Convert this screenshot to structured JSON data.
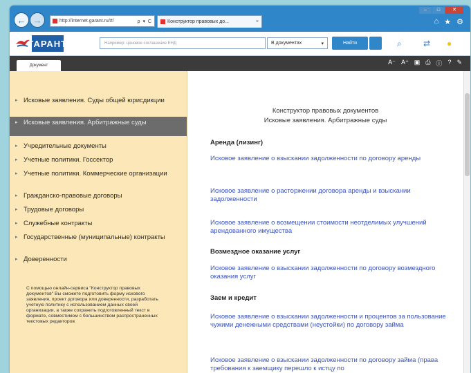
{
  "browser": {
    "address": "http://internet.garant.ru/#/",
    "address_tools": "ρ ▾ C",
    "tab_title": "Конструктор правовых до...",
    "tab_close": "×",
    "back": "←",
    "forward": "→"
  },
  "toolbar": {
    "logo_text": "ГАРАНТ",
    "search_placeholder": "Например: ценовое соглашение ЕНД",
    "scope_label": "В документах",
    "scope_arrow": "▾",
    "find_label": "Найти"
  },
  "doc_tab": "Документ",
  "sidebar": {
    "items": [
      "Исковые заявления. Суды общей юрисдикции",
      "Исковые заявления. Арбитражные суды",
      "Учредительные документы",
      "Учетные политики. Госсектор",
      "Учетные политики. Коммерческие организации",
      "Гражданско-правовые договоры",
      "Трудовые договоры",
      "Служебные контракты",
      "Государственные (муниципальные) контракты",
      "Доверенности"
    ],
    "active_index": 1,
    "note": "С помощью онлайн-сервиса \"Конструктор правовых документов\" Вы сможете подготовить форму искового заявления, проект договора или доверенности, разработать учетную политику с использованием данных своей организации, а также сохранить подготовленный текст в формате, совместимом с большинством распространенных текстовых редакторов"
  },
  "main": {
    "title_line1": "Конструктор правовых документов",
    "title_line2": "Исковые заявления. Арбитражные суды",
    "sections": [
      {
        "heading": "Аренда (лизинг)",
        "links": [
          "Исковое заявление о взыскании задолженности по договору аренды",
          "Исковое заявление о расторжении договора аренды и взыскании задолженности",
          "Исковое заявление о возмещении стоимости неотделимых улучшений арендованного имущества"
        ]
      },
      {
        "heading": "Возмездное оказание услуг",
        "links": [
          "Исковое заявление о взыскании задолженности по договору возмездного оказания услуг"
        ]
      },
      {
        "heading": "Заем и кредит",
        "links": [
          "Исковое заявление о взыскании задолженности и процентов за пользование чужими денежными средствами (неустойки) по договору займа",
          "Исковое заявление о взыскании задолженности по договору займа (права требования к заемщику перешло к истцу по"
        ]
      }
    ]
  },
  "colors": {
    "frame_blue": "#2f86c9",
    "sidebar_bg": "#fbe7b7",
    "active_item_bg": "#6c6c6c",
    "link": "#3a52b8",
    "dark_strip": "#3b3b3b",
    "outer_bg": "#9fd3de"
  }
}
